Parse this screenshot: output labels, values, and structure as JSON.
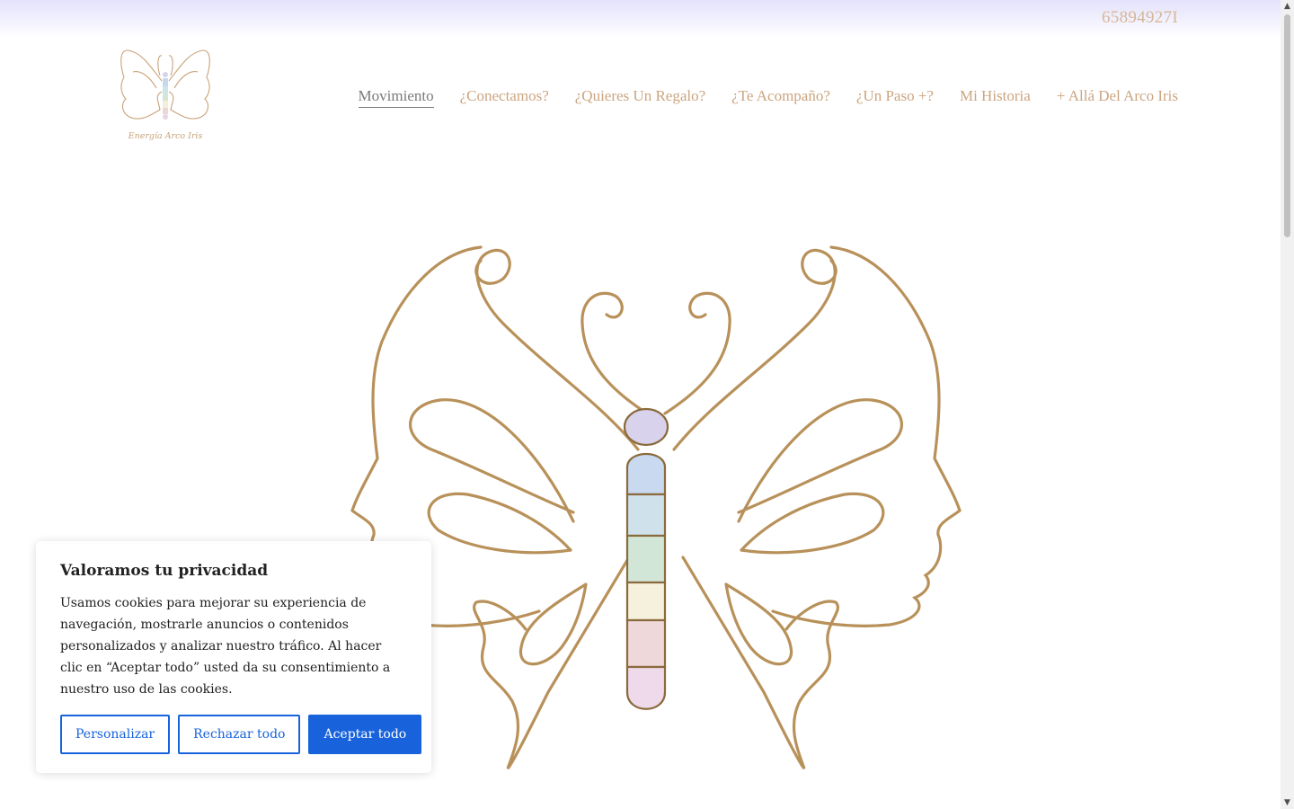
{
  "header": {
    "phone": "65894927I",
    "logo_text": "Energía Arco Iris"
  },
  "nav": {
    "items": [
      {
        "label": "Movimiento",
        "active": true
      },
      {
        "label": "¿Conectamos?",
        "active": false
      },
      {
        "label": "¿Quieres Un Regalo?",
        "active": false
      },
      {
        "label": "¿Te Acompaño?",
        "active": false
      },
      {
        "label": "¿Un Paso +?",
        "active": false
      },
      {
        "label": "Mi Historia",
        "active": false
      },
      {
        "label": "+ Allá Del Arco Iris",
        "active": false
      }
    ]
  },
  "cookie": {
    "title": "Valoramos tu privacidad",
    "body": "Usamos cookies para mejorar su experiencia de navegación, mostrarle anuncios o contenidos personalizados y analizar nuestro tráfico. Al hacer clic en “Aceptar todo” usted da su consentimiento a nuestro uso de las cookies.",
    "customize_label": "Personalizar",
    "reject_label": "Rechazar todo",
    "accept_label": "Aceptar todo"
  },
  "colors": {
    "accent": "#1863dc",
    "nav_text": "#cba580",
    "gold_line": "#b8915a"
  },
  "icons": {
    "logo": "butterfly-logo-icon",
    "hero": "butterfly-illustration-icon"
  }
}
